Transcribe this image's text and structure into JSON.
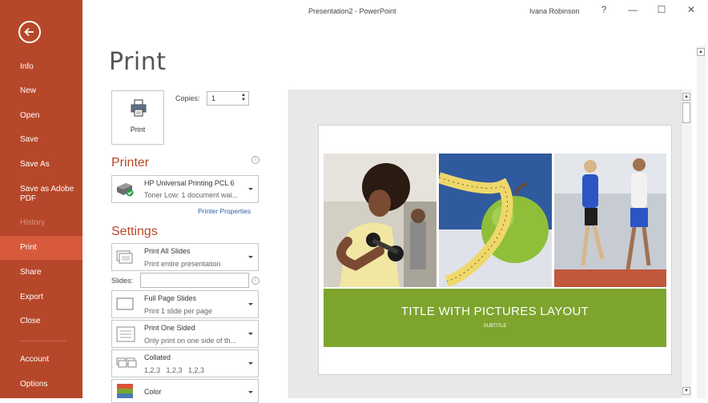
{
  "window": {
    "title": "Presentation2 - PowerPoint",
    "user": "Ivana Robinson",
    "help": "?",
    "minimize": "—",
    "maximize": "☐",
    "close": "✕"
  },
  "sidebar": {
    "items": [
      {
        "label": "Info"
      },
      {
        "label": "New"
      },
      {
        "label": "Open"
      },
      {
        "label": "Save"
      },
      {
        "label": "Save As"
      },
      {
        "label": "Save as Adobe PDF"
      },
      {
        "label": "History"
      },
      {
        "label": "Print"
      },
      {
        "label": "Share"
      },
      {
        "label": "Export"
      },
      {
        "label": "Close"
      },
      {
        "label": "Account"
      },
      {
        "label": "Options"
      }
    ],
    "active": "Print",
    "accent": "#b7472a"
  },
  "print": {
    "title": "Print",
    "button_label": "Print",
    "copies_label": "Copies:",
    "copies_value": "1"
  },
  "printer": {
    "heading": "Printer",
    "name": "HP Universal Printing PCL 6",
    "status": "Toner Low: 1 document wai...",
    "properties_link": "Printer Properties"
  },
  "settings": {
    "heading": "Settings",
    "slides_label": "Slides:",
    "slides_value": "",
    "options": [
      {
        "title": "Print All Slides",
        "desc": "Print entire presentation"
      },
      {
        "title": "Full Page Slides",
        "desc": "Print 1 slide per page"
      },
      {
        "title": "Print One Sided",
        "desc": "Only print on one side of th..."
      },
      {
        "title": "Collated",
        "desc": "1,2,3   1,2,3   1,2,3"
      },
      {
        "title": "Color",
        "desc": ""
      }
    ]
  },
  "preview": {
    "slide_title": "TITLE WITH PICTURES LAYOUT",
    "slide_subtitle": "SUBTITLE",
    "band_color": "#7da52e"
  }
}
